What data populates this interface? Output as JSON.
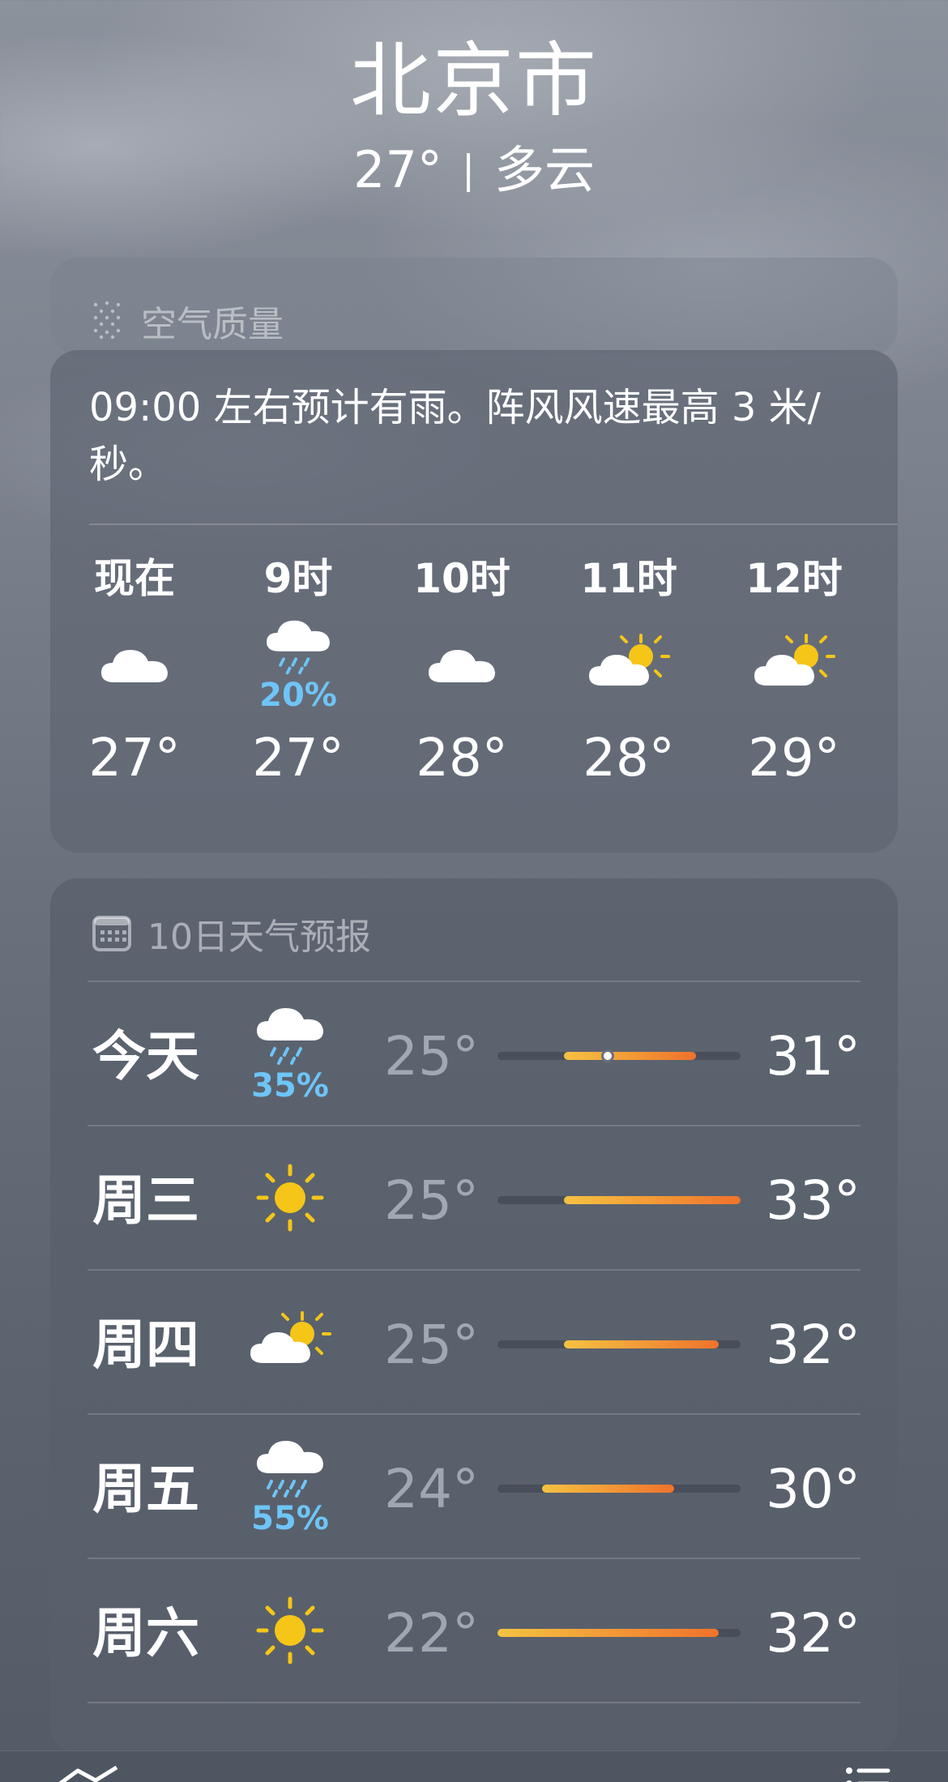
{
  "header": {
    "city": "北京市",
    "temp": "27°",
    "condition": "多云"
  },
  "air_quality": {
    "title": "空气质量",
    "icon": "air-quality-dots-icon"
  },
  "hourly": {
    "summary": "09:00 左右预计有雨。阵风风速最高 3 米/秒。",
    "hours": [
      {
        "label": "现在",
        "icon": "cloud-icon",
        "pop": "",
        "temp": "27°"
      },
      {
        "label": "9时",
        "icon": "cloud-rain-icon",
        "pop": "20%",
        "temp": "27°"
      },
      {
        "label": "10时",
        "icon": "cloud-icon",
        "pop": "",
        "temp": "28°"
      },
      {
        "label": "11时",
        "icon": "partly-cloudy-sun-icon",
        "pop": "",
        "temp": "28°"
      },
      {
        "label": "12时",
        "icon": "partly-cloudy-sun-icon",
        "pop": "",
        "temp": "29°"
      }
    ]
  },
  "daily": {
    "title": "10日天气预报",
    "icon": "calendar-icon",
    "range_min": 22,
    "range_max": 33,
    "current_temp": 27,
    "days": [
      {
        "label": "今天",
        "icon": "cloud-rain-icon",
        "pop": "35%",
        "low": "25°",
        "high": "31°",
        "low_val": 25,
        "high_val": 31,
        "is_today": true
      },
      {
        "label": "周三",
        "icon": "sun-icon",
        "pop": "",
        "low": "25°",
        "high": "33°",
        "low_val": 25,
        "high_val": 33,
        "is_today": false
      },
      {
        "label": "周四",
        "icon": "partly-cloudy-sun-icon",
        "pop": "",
        "low": "25°",
        "high": "32°",
        "low_val": 25,
        "high_val": 32,
        "is_today": false
      },
      {
        "label": "周五",
        "icon": "cloud-rain-icon",
        "pop": "55%",
        "low": "24°",
        "high": "30°",
        "low_val": 24,
        "high_val": 30,
        "is_today": false
      },
      {
        "label": "周六",
        "icon": "sun-icon",
        "pop": "",
        "low": "22°",
        "high": "32°",
        "low_val": 22,
        "high_val": 32,
        "is_today": false
      }
    ]
  },
  "colors": {
    "precip_blue": "#6ec5f7",
    "bar_yellow": "#f5c242",
    "bar_orange": "#f39a2a",
    "bar_red_orange": "#f0722c"
  },
  "bottom_bar": {
    "left_icon": "map-icon",
    "right_icon": "list-icon"
  }
}
